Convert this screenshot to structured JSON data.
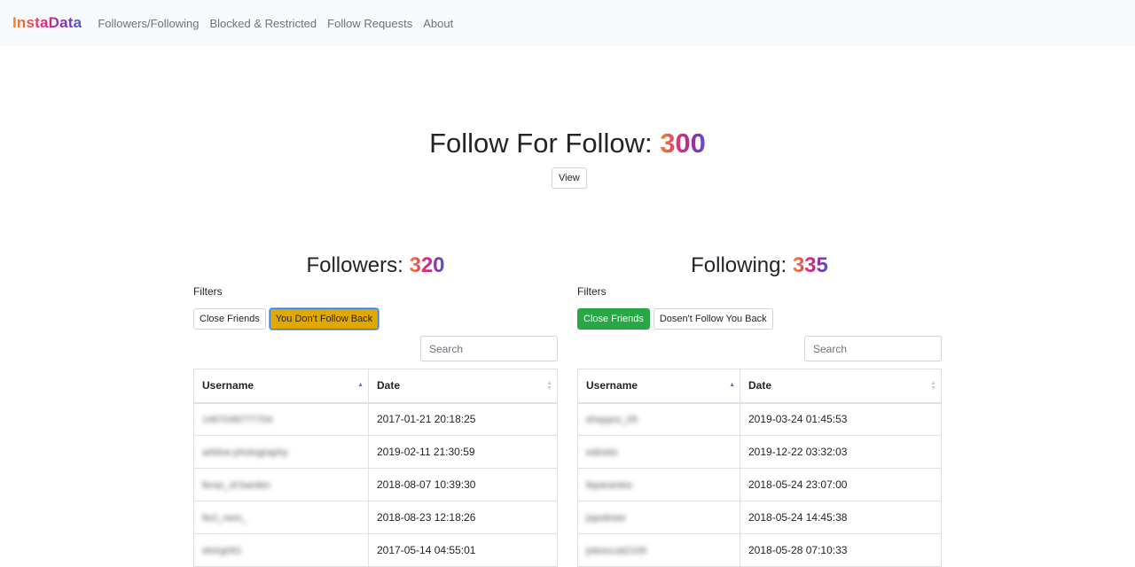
{
  "nav": {
    "brand": "InstaData",
    "links": [
      "Followers/Following",
      "Blocked & Restricted",
      "Follow Requests",
      "About"
    ]
  },
  "hero": {
    "label": "Follow For Follow: ",
    "count": "300",
    "view_button": "View"
  },
  "followers": {
    "title": "Followers: ",
    "count": "320",
    "filters_label": "Filters",
    "filter_buttons": [
      "Close Friends",
      "You Don't Follow Back"
    ],
    "active_filter": "You Don't Follow Back",
    "search_placeholder": "Search",
    "columns": [
      "Username",
      "Date"
    ],
    "rows": [
      {
        "username": "1467048777704",
        "date": "2017-01-21 20:18:25"
      },
      {
        "username": "arktive.photography",
        "date": "2019-02-11 21:30:59"
      },
      {
        "username": "feraz_of.barden",
        "date": "2018-08-07 10:39:30"
      },
      {
        "username": "fecl_nem_",
        "date": "2018-08-23 12:18:26"
      },
      {
        "username": "elvirg091",
        "date": "2017-05-14 04:55:01"
      }
    ]
  },
  "following": {
    "title": "Following: ",
    "count": "335",
    "filters_label": "Filters",
    "filter_buttons": [
      "Close Friends",
      "Dosen't Follow You Back"
    ],
    "active_filter": "Close Friends",
    "search_placeholder": "Search",
    "columns": [
      "Username",
      "Date"
    ],
    "rows": [
      {
        "username": "ehaypro_05",
        "date": "2019-03-24 01:45:53"
      },
      {
        "username": "edinelo",
        "date": "2019-12-22 03:32:03"
      },
      {
        "username": "feparantes",
        "date": "2018-05-24 23:07:00"
      },
      {
        "username": "jopotinee",
        "date": "2018-05-24 14:45:38"
      },
      {
        "username": "jotesccat2109",
        "date": "2018-05-28 07:10:33"
      }
    ]
  },
  "colors": {
    "navbar_bg": "#f8f9fa",
    "active_filter_yellow": "#e0a800",
    "active_filter_green": "#28a745",
    "gradient": [
      "#f58529",
      "#dd2a7b",
      "#8134af",
      "#515bd4"
    ]
  }
}
